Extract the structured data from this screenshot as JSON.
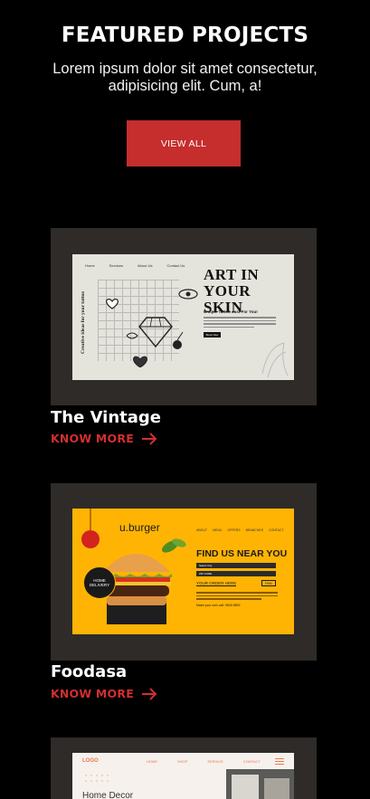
{
  "section": {
    "title": "FEATURED PROJECTS",
    "subtitle": "Lorem ipsum dolor sit amet consectetur, adipisicing elit. Cum, a!",
    "view_all_label": "VIEW ALL"
  },
  "colors": {
    "background": "#000000",
    "accent": "#c62d2d",
    "card_frame": "#2e2b29",
    "burger_yellow": "#ffb404"
  },
  "projects": [
    {
      "title": "The Vintage",
      "link_label": "KNOW MORE",
      "link_icon": "arrow-right-icon",
      "preview": {
        "nav": [
          "Home",
          "Services",
          "About Us",
          "Contact Us"
        ],
        "side_text": "Creative ideas for your tattoo",
        "headline_line1": "ART IN",
        "headline_line2": "YOUR SKIN",
        "tagline": "Unique Tattoo Just For You!",
        "button": "Book Now"
      }
    },
    {
      "title": "Foodasa",
      "link_label": "KNOW MORE",
      "link_icon": "arrow-right-icon",
      "preview": {
        "logo": "u.burger",
        "nav": [
          "ABOUT",
          "MENU",
          "OFFERS",
          "BRANCHES",
          "CONTACT"
        ],
        "headline": "FIND US NEAR YOU",
        "select_1": "Select City",
        "select_2": "ZIP CODE",
        "order_link": "YOUR ORDER HERE",
        "find_button": "FIND",
        "call_text": "Make your own call: 9845 8899",
        "delivery_badge": "HOME DELIVERY"
      }
    },
    {
      "preview": {
        "logo": "LOGO",
        "nav": [
          "HOME",
          "SHOP",
          "SERVICE",
          "CONTACT"
        ],
        "hero": "Home  Decor"
      }
    }
  ]
}
